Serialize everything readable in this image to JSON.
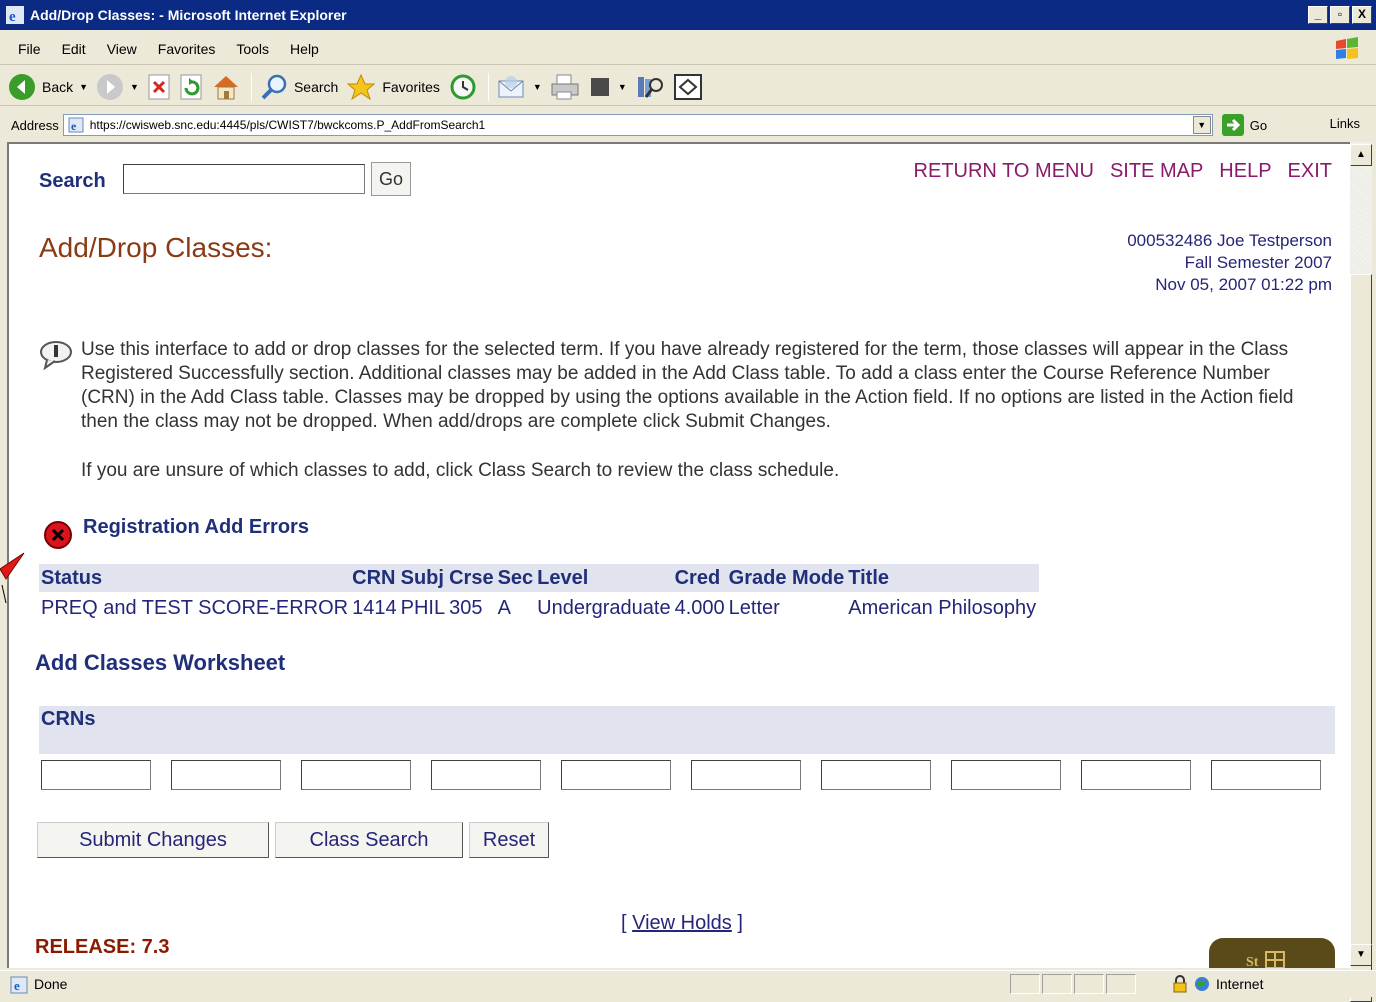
{
  "window": {
    "title": "Add/Drop Classes: - Microsoft Internet Explorer",
    "min": "_",
    "max": "▫",
    "close": "X"
  },
  "menu": [
    "File",
    "Edit",
    "View",
    "Favorites",
    "Tools",
    "Help"
  ],
  "toolbar": {
    "back": "Back",
    "search": "Search",
    "favorites": "Favorites"
  },
  "address": {
    "label": "Address",
    "url": "https://cwisweb.snc.edu:4445/pls/CWIST7/bwckcoms.P_AddFromSearch1",
    "go": "Go",
    "links": "Links"
  },
  "page": {
    "search_label": "Search",
    "search_value": "",
    "search_go": "Go",
    "top_links": [
      "RETURN TO MENU",
      "SITE MAP",
      "HELP",
      "EXIT"
    ],
    "title": "Add/Drop Classes:",
    "user_line1": "000532486 Joe Testperson",
    "user_line2": "Fall Semester 2007",
    "user_line3": "Nov 05, 2007 01:22 pm",
    "instructions": "Use this interface to add or drop classes for the selected term. If you have already registered for the term, those classes will appear in the Class Registered Successfully section. Additional classes may be added in the Add Class table. To add a class enter the Course Reference Number (CRN) in the Add Class table. Classes may be dropped by using the options available in the Action field. If no options are listed in the Action field then the class may not be dropped. When add/drops are complete click Submit Changes.",
    "instructions2": "If you are unsure of which classes to add, click Class Search to review the class schedule.",
    "error_title": "Registration Add Errors",
    "error_table": {
      "headers": [
        "Status",
        "CRN",
        "Subj",
        "Crse",
        "Sec",
        "Level",
        "Cred",
        "Grade Mode",
        "Title"
      ],
      "rows": [
        [
          "PREQ and TEST SCORE-ERROR",
          "1414",
          "PHIL",
          "305",
          "A",
          "Undergraduate",
          "4.000",
          "Letter",
          "American Philosophy"
        ]
      ]
    },
    "worksheet_title": "Add Classes Worksheet",
    "crns_label": "CRNs",
    "crn_values": [
      "",
      "",
      "",
      "",
      "",
      "",
      "",
      "",
      "",
      ""
    ],
    "buttons": {
      "submit": "Submit Changes",
      "class_search": "Class Search",
      "reset": "Reset"
    },
    "view_holds": "View Holds",
    "release": "RELEASE: 7.3"
  },
  "status": {
    "done": "Done",
    "zone": "Internet"
  }
}
